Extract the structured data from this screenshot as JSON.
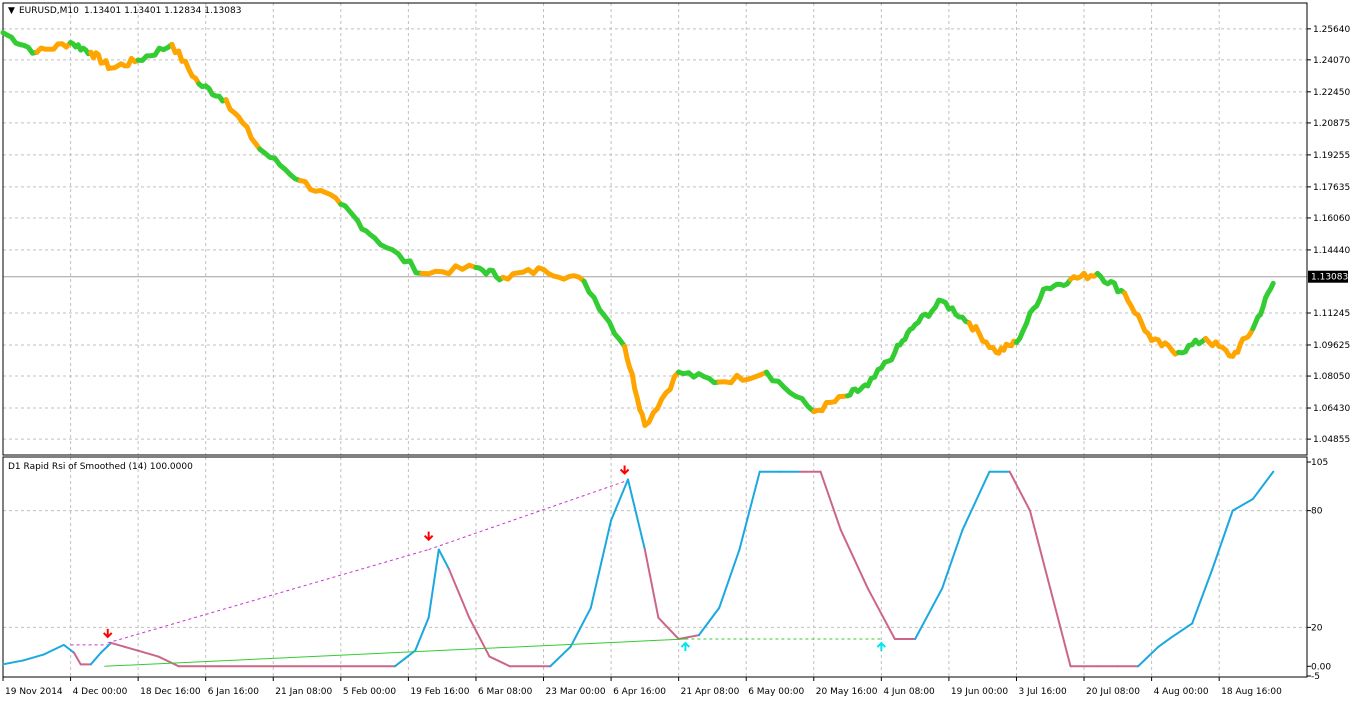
{
  "main_panel": {
    "header_symbol": "EURUSD,M10",
    "header_ohlc": "1.13401 1.13401 1.12834 1.13083",
    "current_price_label": "1.13083",
    "up_color": "#33cc33",
    "down_color": "#ffa500"
  },
  "indicator_panel": {
    "header": "D1 Rapid Rsi of Smoothed (14) 100.0000",
    "rise_color": "#1ba8e0",
    "fall_color": "#cc6688",
    "divergence_top_color": "#cc33cc",
    "divergence_bottom_color": "#33cc33",
    "arrow_down_color": "#ff0000",
    "arrow_up_color": "#00e5ee"
  },
  "chart_data": [
    {
      "type": "line",
      "name_hint": "price",
      "ylim": [
        1.0405,
        1.2695
      ],
      "y_ticks": [
        "1.25640",
        "1.24070",
        "1.22450",
        "1.20875",
        "1.19255",
        "1.17635",
        "1.16060",
        "1.14440",
        "1.11245",
        "1.09625",
        "1.08050",
        "1.06430",
        "1.04855"
      ],
      "x_ticks": [
        "19 Nov 2014",
        "4 Dec 00:00",
        "18 Dec 16:00",
        "6 Jan 16:00",
        "21 Jan 08:00",
        "5 Feb 00:00",
        "19 Feb 16:00",
        "6 Mar 08:00",
        "23 Mar 00:00",
        "6 Apr 16:00",
        "21 Apr 08:00",
        "6 May 00:00",
        "20 May 16:00",
        "4 Jun 08:00",
        "19 Jun 00:00",
        "3 Jul 16:00",
        "20 Jul 08:00",
        "4 Aug 00:00",
        "18 Aug 16:00"
      ],
      "x": [
        0,
        0.5,
        1,
        1.3,
        1.6,
        2,
        2.5,
        2.9,
        3.3,
        3.8,
        4.4,
        5,
        5.5,
        6.2,
        7,
        7.4,
        8,
        8.6,
        9.2,
        9.5,
        10,
        10.6,
        11.3,
        12,
        12.5,
        12.8,
        13.2,
        13.5,
        13.9,
        14.3,
        14.7,
        15,
        15.4,
        15.8,
        16.2,
        16.6,
        17,
        17.4,
        17.8,
        18.2,
        18.5,
        18.8
      ],
      "y": [
        1.2545,
        1.2445,
        1.2495,
        1.2445,
        1.2365,
        1.2405,
        1.2485,
        1.2285,
        1.2205,
        1.1955,
        1.1795,
        1.1675,
        1.1505,
        1.1325,
        1.1355,
        1.1305,
        1.1345,
        1.1285,
        1.0955,
        1.0555,
        1.0825,
        1.0775,
        1.0825,
        1.0625,
        1.0705,
        1.0755,
        1.0925,
        1.1065,
        1.1185,
        1.1075,
        1.0925,
        1.0975,
        1.1245,
        1.1295,
        1.1325,
        1.1225,
        1.0985,
        1.0925,
        1.0995,
        1.0905,
        1.1045,
        1.1275
      ],
      "trend": [
        "up",
        "down",
        "up",
        "down",
        "down",
        "up",
        "down",
        "up",
        "down",
        "up",
        "down",
        "up",
        "up",
        "down",
        "up",
        "down",
        "down",
        "up",
        "down",
        "down",
        "up",
        "down",
        "up",
        "down",
        "up",
        "up",
        "up",
        "up",
        "up",
        "down",
        "down",
        "up",
        "up",
        "down",
        "up",
        "down",
        "down",
        "up",
        "down",
        "down",
        "up",
        "down"
      ],
      "current_price": 1.13083
    },
    {
      "type": "line",
      "name_hint": "rsi",
      "ylim": [
        -5,
        105
      ],
      "y_ticks": [
        "105",
        "80",
        "20",
        "0.00",
        "-5"
      ],
      "x": [
        0,
        0.3,
        0.6,
        0.9,
        1.05,
        1.15,
        1.3,
        1.45,
        1.6,
        1.8,
        2.0,
        2.3,
        2.6,
        3.0,
        3.2,
        5.8,
        6.1,
        6.3,
        6.45,
        6.6,
        6.9,
        7.2,
        7.5,
        8.1,
        8.4,
        8.7,
        9.0,
        9.25,
        9.5,
        9.7,
        10.0,
        10.3,
        10.6,
        10.9,
        11.2,
        11.5,
        11.8,
        12.1,
        12.4,
        12.8,
        13.2,
        13.5,
        13.9,
        14.2,
        14.6,
        14.9,
        15.2,
        15.5,
        15.8,
        16.2,
        16.5,
        16.8,
        17.1,
        17.3,
        17.6,
        17.9,
        18.2,
        18.5,
        18.8
      ],
      "y": [
        1,
        3,
        6,
        11,
        7,
        1,
        1,
        7,
        12,
        10,
        8,
        5,
        0,
        0,
        0,
        0,
        8,
        25,
        60,
        50,
        25,
        5,
        0,
        0,
        10,
        30,
        75,
        96,
        60,
        25,
        14,
        16,
        30,
        60,
        100,
        100,
        100,
        100,
        70,
        40,
        14,
        14,
        40,
        70,
        100,
        100,
        80,
        40,
        0,
        0,
        0,
        0,
        10,
        15,
        22,
        50,
        80,
        86,
        100
      ],
      "trend": [
        "up",
        "up",
        "up",
        "up",
        "down",
        "down",
        "up",
        "up",
        "down",
        "down",
        "down",
        "down",
        "down",
        "down",
        "down",
        "up",
        "up",
        "up",
        "up",
        "down",
        "down",
        "down",
        "down",
        "up",
        "up",
        "up",
        "up",
        "up",
        "down",
        "down",
        "down",
        "up",
        "up",
        "up",
        "up",
        "up",
        "down",
        "down",
        "down",
        "down",
        "down",
        "up",
        "up",
        "up",
        "up",
        "down",
        "down",
        "down",
        "down",
        "down",
        "down",
        "up",
        "up",
        "up",
        "up",
        "up",
        "up",
        "up",
        "up"
      ],
      "down_arrows": [
        {
          "x": 1.55,
          "y": 12
        },
        {
          "x": 6.3,
          "y": 62
        },
        {
          "x": 9.2,
          "y": 96
        }
      ],
      "up_arrows": [
        {
          "x": 10.1,
          "y": 14
        },
        {
          "x": 13.0,
          "y": 14
        }
      ],
      "top_divergence": [
        {
          "x1": 1.0,
          "y1": 11,
          "x2": 1.55,
          "y2": 11
        },
        {
          "x1": 1.55,
          "y1": 12,
          "x2": 6.3,
          "y2": 60
        },
        {
          "x1": 6.3,
          "y1": 60,
          "x2": 9.2,
          "y2": 95
        }
      ],
      "bottom_divergence": [
        {
          "x1": 1.5,
          "y1": 0,
          "x2": 10.1,
          "y2": 14,
          "style": "solid"
        },
        {
          "x1": 10.1,
          "y1": 14,
          "x2": 13.0,
          "y2": 14,
          "style": "dashed"
        }
      ]
    }
  ]
}
